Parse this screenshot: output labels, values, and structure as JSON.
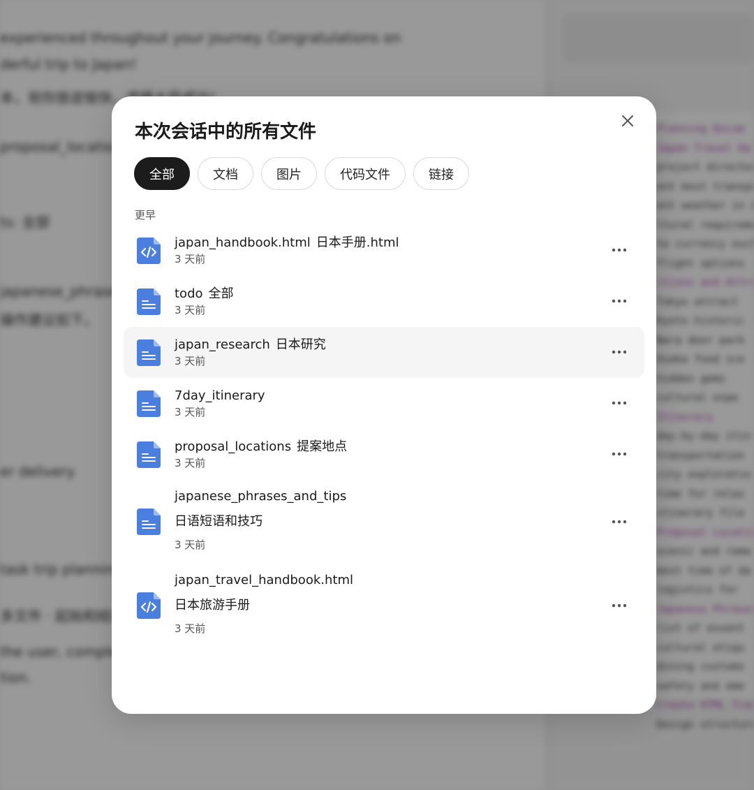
{
  "modal": {
    "title": "本次会话中的所有文件",
    "close_icon": "close-icon"
  },
  "tabs": [
    {
      "label": "全部",
      "active": true
    },
    {
      "label": "文档",
      "active": false
    },
    {
      "label": "图片",
      "active": false
    },
    {
      "label": "代码文件",
      "active": false
    },
    {
      "label": "链接",
      "active": false
    }
  ],
  "section_label": "更早",
  "files": [
    {
      "name": "japan_handbook.html",
      "title": "日本手册.html",
      "time": "3 天前",
      "icon": "code-file-icon"
    },
    {
      "name": "todo",
      "title": "全部",
      "time": "3 天前",
      "icon": "document-icon"
    },
    {
      "name": "japan_research",
      "title": "日本研究",
      "time": "3 天前",
      "icon": "document-icon"
    },
    {
      "name": "7day_itinerary",
      "title": "",
      "time": "3 天前",
      "icon": "document-icon"
    },
    {
      "name": "proposal_locations",
      "title": "提案地点",
      "time": "3 天前",
      "icon": "document-icon"
    },
    {
      "name": "japanese_phrases_and_tips",
      "title": "日语短语和技巧",
      "time": "3 天前",
      "icon": "document-icon"
    },
    {
      "name": "japan_travel_handbook.html",
      "title": "日本旅游手册",
      "time": "3 天前",
      "icon": "code-file-icon"
    }
  ],
  "more_icon": "more-horizontal-icon",
  "colors": {
    "file_icon_blue": "#4a7fe0",
    "active_tab_bg": "#1c1c1c",
    "hover_row_bg": "#f5f5f5"
  },
  "background": {
    "left_lines": [
      "experienced throughout your journey. Congratulations on",
      "derful trip to Japan!",
      "本，祝你旅途愉快，求婚大获成功！",
      "proposal_locations",
      "ts: 全部",
      "japanese_phrases_an",
      "操作建议如下。",
      "er delivery",
      "task trip planning",
      "多文件 · 起始和结束",
      "the user, completed",
      "tion."
    ],
    "right_lines": [
      "Planning Docum",
      "Japan Travel Ha",
      "project director",
      "ent best transpo",
      "ent weather in Ap",
      "ltural requiremen",
      "te currency excha",
      "flight options",
      "ctions and Attrac",
      "Tokyo attract",
      "Kyoto historic",
      "Nara deer park",
      "Osaka food sce",
      "hidden gems",
      "cultural expe",
      "Itinerary",
      "day-by-day itin",
      "transportation",
      "city exploratio",
      "time for relax",
      "itinerary file",
      "Proposal Location",
      "scenic and roma",
      "best time of da",
      "logistics for",
      "Japanese Phrases",
      "list of essent",
      "cultural etiqu",
      "dining customs",
      "safety and eme",
      "Create HTML Travel Handbo",
      "Design structure for"
    ]
  }
}
